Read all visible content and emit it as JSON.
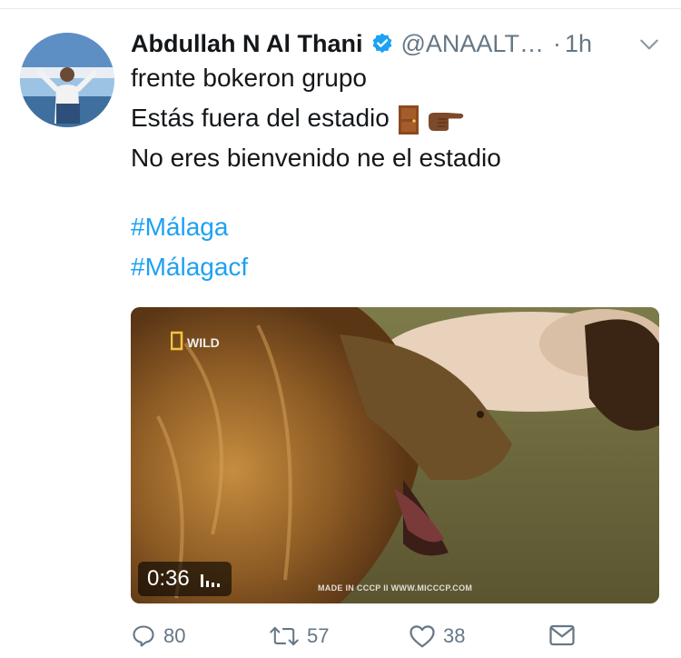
{
  "author": {
    "display_name": "Abdullah N Al Thani",
    "handle": "@ANAALT…",
    "separator": "·",
    "time": "1h",
    "verified": true
  },
  "tweet": {
    "lines": [
      "frente bokeron grupo",
      "Estás fuera del estadio",
      "No eres bienvenido ne el estadio"
    ],
    "emojis_after_line_2": [
      "door",
      "backhand-index-pointing-right"
    ],
    "hashtags": [
      "#Málaga",
      "#Málagacf"
    ]
  },
  "media": {
    "duration": "0:36",
    "watermark_logo": "WILD",
    "watermark_text": "MADE IN CCCP II WWW.MICCCP.COM"
  },
  "actions": {
    "reply_count": "80",
    "retweet_count": "57",
    "like_count": "38"
  },
  "colors": {
    "link": "#1da1f2",
    "meta": "#657786",
    "verified": "#1da1f2"
  }
}
